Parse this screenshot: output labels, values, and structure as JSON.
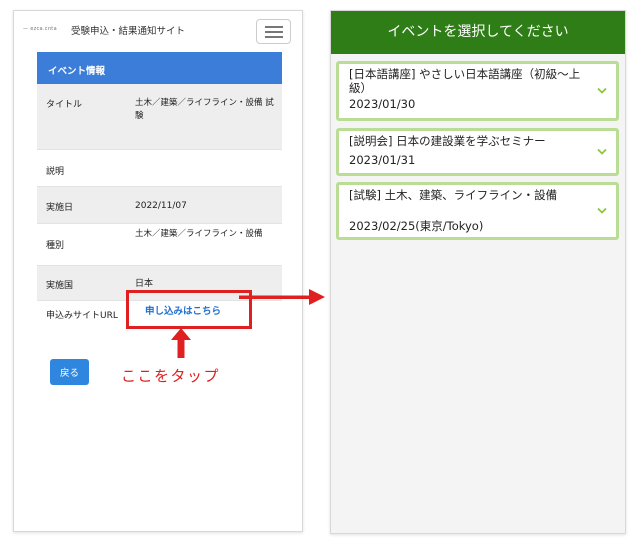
{
  "left": {
    "logo": "— ezca.cnta",
    "site_title": "受験申込・結果通知サイト",
    "menu_icon": "hamburger-menu-icon",
    "table_header": "イベント情報",
    "rows": {
      "title": {
        "label": "タイトル",
        "value": "土木／建築／ライフライン・設備 試験"
      },
      "description": {
        "label": "説明",
        "value": ""
      },
      "date": {
        "label": "実施日",
        "value": "2022/11/07"
      },
      "type": {
        "label": "種別",
        "value": "土木／建築／ライフライン・設備"
      },
      "country": {
        "label": "実施国",
        "value": "日本"
      },
      "url": {
        "label": "申込みサイトURL",
        "link": "申し込みはこちら"
      }
    },
    "back_button": "戻る",
    "annotation": "ここをタップ",
    "highlight_color": "#e02020",
    "accent_color": "#3b7dd8"
  },
  "right": {
    "header": "イベントを選択してください",
    "header_color": "#2e7d17",
    "events": [
      {
        "title": "[日本語講座] やさしい日本語講座（初級～上級）",
        "date": "2023/01/30"
      },
      {
        "title": "[説明会] 日本の建設業を学ぶセミナー",
        "date": "2023/01/31"
      },
      {
        "title": "[試験] 土木、建築、ライフライン・設備",
        "date": "2023/02/25(東京/Tokyo)"
      }
    ],
    "chevron_icon": "chevron-down-icon",
    "card_border_color": "#b9dd94"
  }
}
